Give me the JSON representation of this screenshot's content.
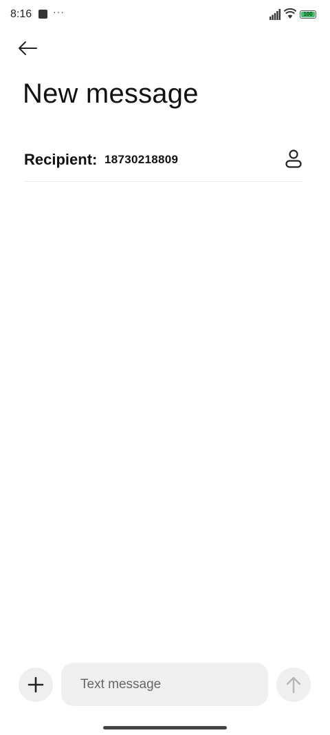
{
  "status_bar": {
    "time": "8:16",
    "dots": "···",
    "battery_level": "100",
    "battery_color": "#3cc46b",
    "icons": [
      "app-square-icon",
      "signal-icon",
      "wifi-icon",
      "battery-icon"
    ]
  },
  "header": {
    "back_icon": "arrow-left-icon",
    "title": "New message"
  },
  "recipient": {
    "label": "Recipient:",
    "value": "18730218809",
    "contact_icon": "person-icon"
  },
  "composer": {
    "add_icon": "plus-icon",
    "placeholder": "Text message",
    "value": "",
    "send_icon": "arrow-up-icon"
  }
}
